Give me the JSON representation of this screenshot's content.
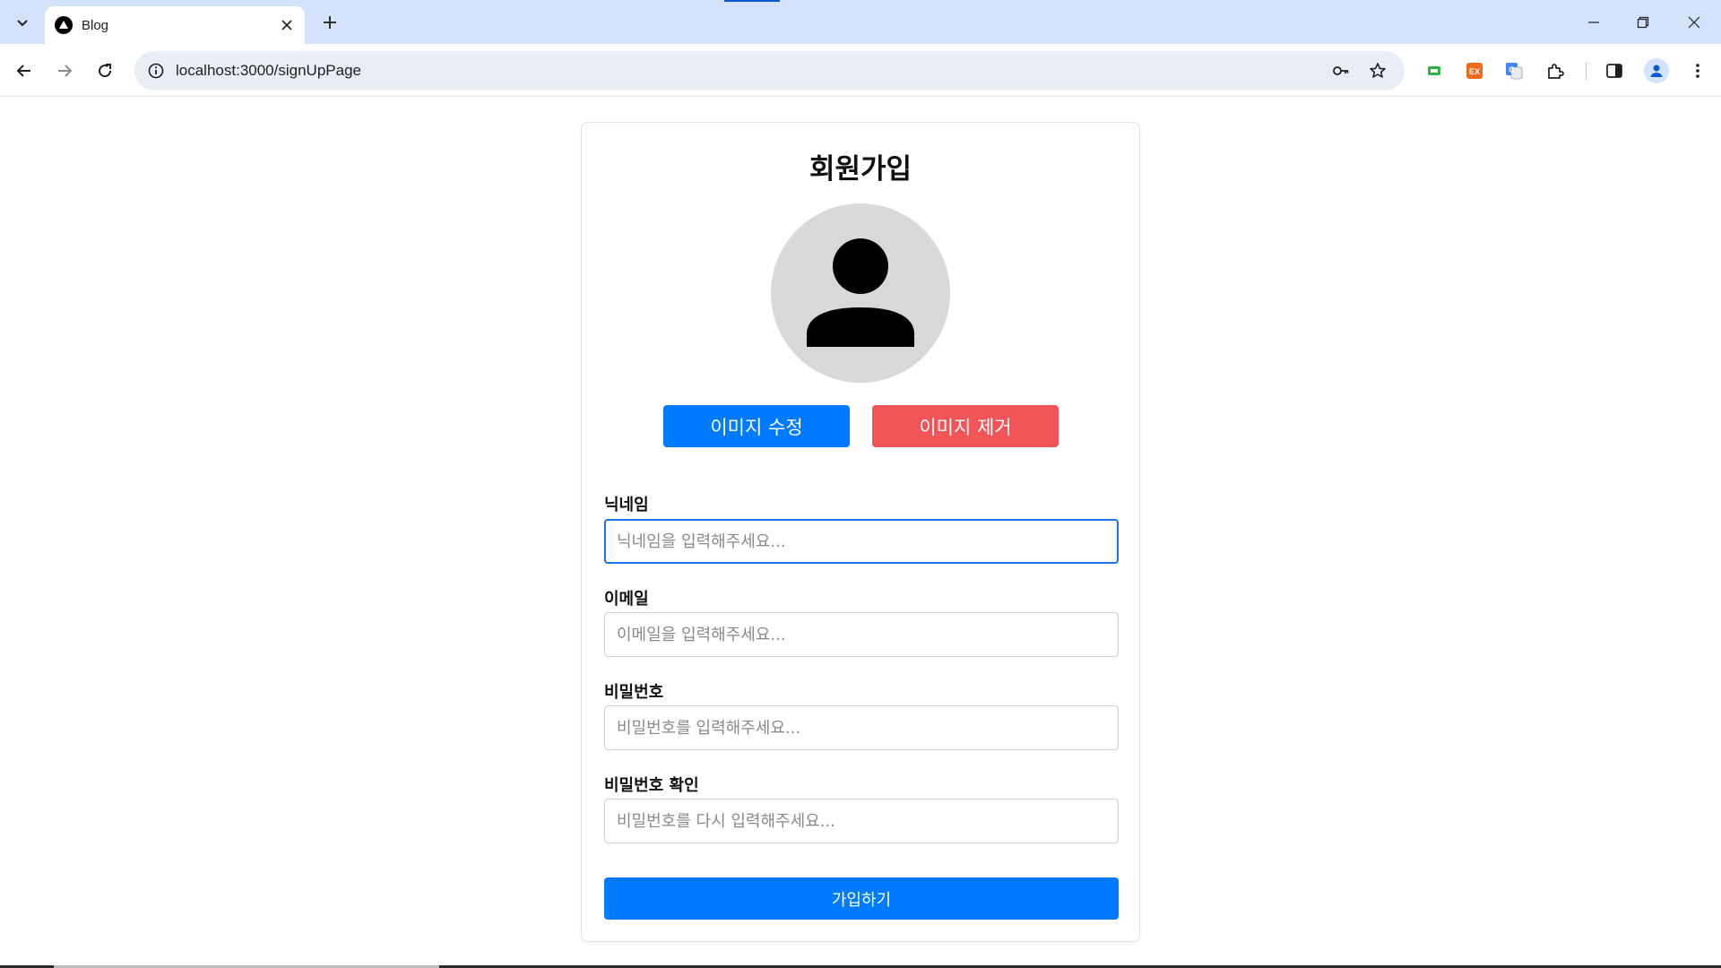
{
  "browser": {
    "tab_title": "Blog",
    "url": "localhost:3000/signUpPage",
    "accent_color": "#0b57d0",
    "icons": [
      "tab-search-icon",
      "favicon-triangle-icon",
      "close-icon",
      "plus-icon",
      "minimize-icon",
      "restore-icon",
      "window-close-icon",
      "back-arrow-icon",
      "forward-arrow-icon",
      "reload-icon",
      "site-info-icon",
      "key-icon",
      "star-icon",
      "extension-icon",
      "side-panel-icon",
      "profile-icon",
      "more-vertical-icon"
    ]
  },
  "signup": {
    "title": "회원가입",
    "avatar_icon": "user-silhouette-icon",
    "edit_image_label": "이미지 수정",
    "remove_image_label": "이미지 제거",
    "fields": [
      {
        "label": "닉네임",
        "placeholder": "닉네임을 입력해주세요...",
        "value": ""
      },
      {
        "label": "이메일",
        "placeholder": "이메일을 입력해주세요...",
        "value": ""
      },
      {
        "label": "비밀번호",
        "placeholder": "비밀번호를 입력해주세요...",
        "value": ""
      },
      {
        "label": "비밀번호 확인",
        "placeholder": "비밀번호를 다시 입력해주세요...",
        "value": ""
      }
    ],
    "submit_label": "가입하기",
    "colors": {
      "primary": "#007bff",
      "danger": "#f25557",
      "avatar_bg": "#d9d9d9"
    }
  }
}
